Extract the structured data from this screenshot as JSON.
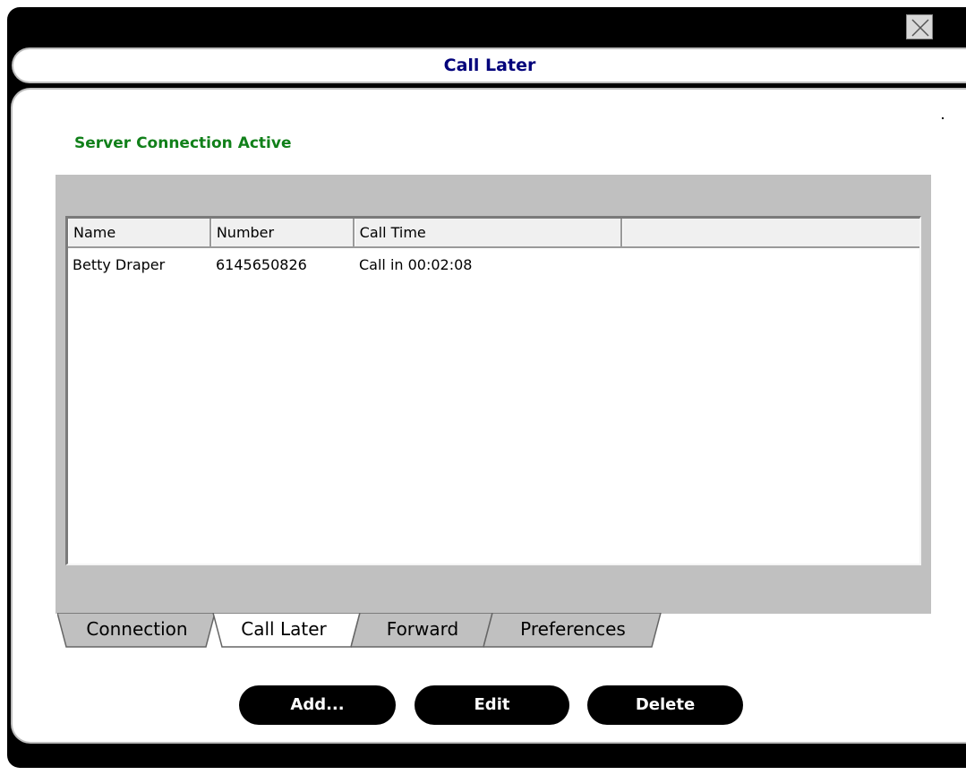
{
  "window": {
    "title": "Call Later"
  },
  "status": {
    "text": "Server Connection Active",
    "color": "#11801a"
  },
  "table": {
    "columns": [
      "Name",
      "Number",
      "Call Time",
      ""
    ],
    "rows": [
      {
        "name": "Betty Draper",
        "number": "6145650826",
        "call_time": "Call in 00:02:08"
      }
    ]
  },
  "tabs": [
    {
      "label": "Connection",
      "active": false
    },
    {
      "label": "Call Later",
      "active": true
    },
    {
      "label": "Forward",
      "active": false
    },
    {
      "label": "Preferences",
      "active": false
    }
  ],
  "buttons": {
    "add": "Add...",
    "edit": "Edit",
    "delete": "Delete"
  },
  "icons": {
    "close": "close-icon"
  }
}
